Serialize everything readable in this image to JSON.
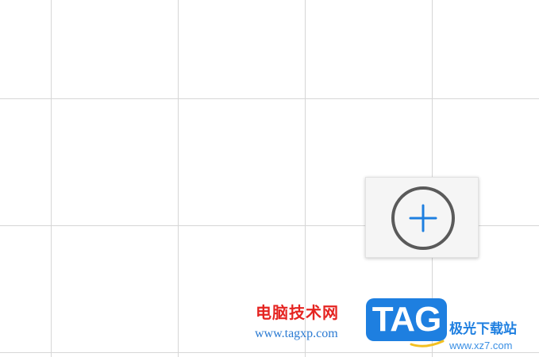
{
  "canvas": {
    "grid_color": "#d6d6d6",
    "background": "#ffffff"
  },
  "add_button": {
    "icon": "plus-circle-icon",
    "ring_color": "#5a5a5a",
    "plus_color": "#1e7fe0"
  },
  "watermark": {
    "site_name": "电脑技术网",
    "site_url": "www.tagxp.com",
    "logo_text": "TAG",
    "brand_cn": "极光下载站",
    "brand_url": "www.xz7.com"
  }
}
